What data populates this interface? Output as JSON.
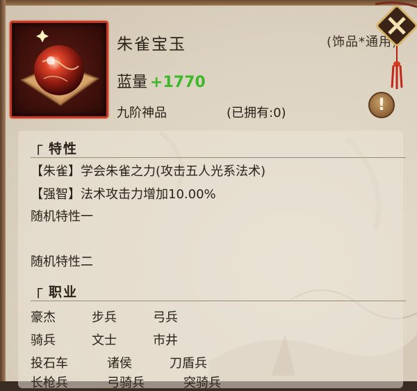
{
  "item": {
    "name": "朱雀宝玉",
    "type": "(饰品*通用)",
    "stat_label": "蓝量",
    "stat_value": "+1770",
    "quality": "九阶神品",
    "owned": "(已拥有:0)"
  },
  "traits": {
    "title": "特性",
    "lines": [
      "【朱雀】学会朱雀之力(攻击五人光系法术)",
      "【强智】法术攻击力增加10.00%",
      "随机特性一",
      "随机特性二"
    ]
  },
  "jobs": {
    "title": "职业",
    "rows": [
      [
        "豪杰",
        "步兵",
        "弓兵"
      ],
      [
        "骑兵",
        "文士",
        "市井"
      ],
      [
        "投石车",
        "诸侯",
        "刀盾兵"
      ],
      [
        "长枪兵",
        "弓骑兵",
        "突骑兵"
      ]
    ]
  },
  "colors": {
    "stat_value": "#3db82a",
    "frame_border": "#c9371f",
    "text": "#2a2118"
  },
  "icons": [
    "close-tag-icon",
    "info-icon",
    "item-orb-icon"
  ]
}
